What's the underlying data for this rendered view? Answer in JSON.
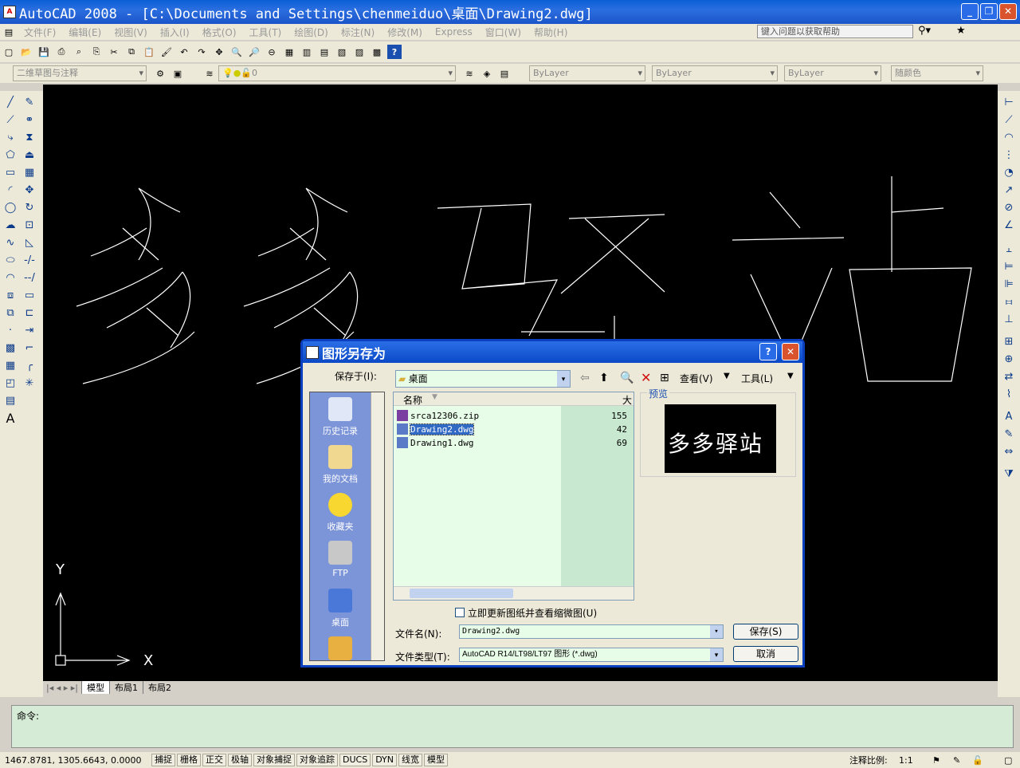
{
  "window": {
    "title": "AutoCAD 2008 - [C:\\Documents and Settings\\chenmeiduo\\桌面\\Drawing2.dwg]"
  },
  "menu": [
    "文件(F)",
    "编辑(E)",
    "视图(V)",
    "插入(I)",
    "格式(O)",
    "工具(T)",
    "绘图(D)",
    "标注(N)",
    "修改(M)",
    "Express",
    "窗口(W)",
    "帮助(H)"
  ],
  "help_placeholder": "键入问题以获取帮助",
  "toolbar2": {
    "workspace": "二维草图与注释",
    "layer": "0",
    "color": "ByLayer",
    "linetype": "ByLayer",
    "lineweight": "ByLayer",
    "plotstyle": "随颜色"
  },
  "drawing_text": "多多驿站",
  "ucs": {
    "x": "X",
    "y": "Y"
  },
  "layout_tabs": [
    "模型",
    "布局1",
    "布局2"
  ],
  "command": {
    "prompt": "命令:"
  },
  "status": {
    "coords": "1467.8781, 1305.6643, 0.0000",
    "toggles": [
      "捕捉",
      "栅格",
      "正交",
      "极轴",
      "对象捕捉",
      "对象追踪",
      "DUCS",
      "DYN",
      "线宽",
      "模型"
    ],
    "annotation_scale_label": "注释比例:",
    "annotation_scale": "1:1"
  },
  "dialog": {
    "title": "图形另存为",
    "save_in_label": "保存于(I):",
    "save_in_value": "桌面",
    "view_label": "查看(V)",
    "tools_label": "工具(L)",
    "places": [
      {
        "label": "历史记录",
        "color": "#e0e8f8"
      },
      {
        "label": "我的文档",
        "color": "#f0d890"
      },
      {
        "label": "收藏夹",
        "color": "#f8d830"
      },
      {
        "label": "FTP",
        "color": "#c8c8c8"
      },
      {
        "label": "桌面",
        "color": "#4a78d8"
      }
    ],
    "columns": {
      "name": "名称",
      "size": "大"
    },
    "files": [
      {
        "name": "srca12306.zip",
        "size": "155"
      },
      {
        "name": "Drawing2.dwg",
        "size": "42"
      },
      {
        "name": "Drawing1.dwg",
        "size": "69"
      }
    ],
    "preview_label": "预览",
    "update_checkbox": "立即更新图纸并查看缩微图(U)",
    "filename_label": "文件名(N):",
    "filename_value": "Drawing2.dwg",
    "filetype_label": "文件类型(T):",
    "filetype_value": "AutoCAD R14/LT98/LT97 图形 (*.dwg)",
    "save_button": "保存(S)",
    "cancel_button": "取消"
  }
}
